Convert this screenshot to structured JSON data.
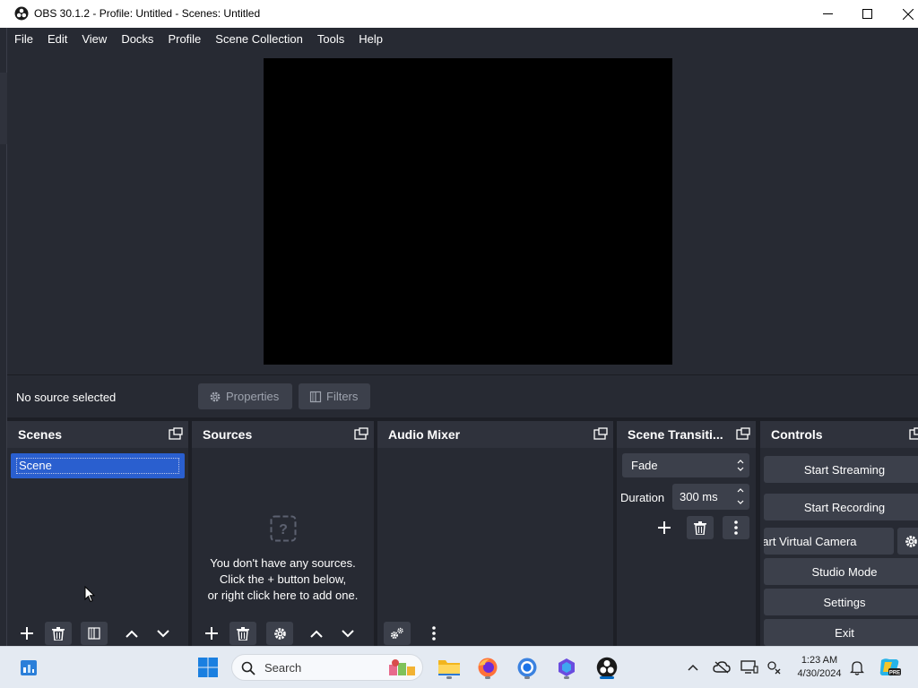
{
  "window": {
    "title": "OBS 30.1.2 - Profile: Untitled - Scenes: Untitled"
  },
  "menu": [
    "File",
    "Edit",
    "View",
    "Docks",
    "Profile",
    "Scene Collection",
    "Tools",
    "Help"
  ],
  "context_bar": {
    "status": "No source selected",
    "properties_label": "Properties",
    "filters_label": "Filters"
  },
  "docks": {
    "scenes": {
      "title": "Scenes",
      "items": [
        "Scene"
      ]
    },
    "sources": {
      "title": "Sources",
      "empty_line1": "You don't have any sources.",
      "empty_line2": "Click the + button below,",
      "empty_line3": "or right click here to add one."
    },
    "audio_mixer": {
      "title": "Audio Mixer"
    },
    "transitions": {
      "title": "Scene Transiti...",
      "selected": "Fade",
      "duration_label": "Duration",
      "duration_value": "300 ms"
    },
    "controls": {
      "title": "Controls",
      "start_streaming": "Start Streaming",
      "start_recording": "Start Recording",
      "start_virtual_camera": "Start Virtual Camera",
      "studio_mode": "Studio Mode",
      "settings": "Settings",
      "exit": "Exit"
    }
  },
  "taskbar": {
    "search_label": "Search",
    "time": "1:23 AM",
    "date": "4/30/2024"
  },
  "colors": {
    "panel_bg": "#272a33",
    "header_bg": "#2f323c",
    "button_bg": "#3c404b",
    "selection": "#2a5fcf",
    "taskbar_bg": "#e4eaf2"
  }
}
